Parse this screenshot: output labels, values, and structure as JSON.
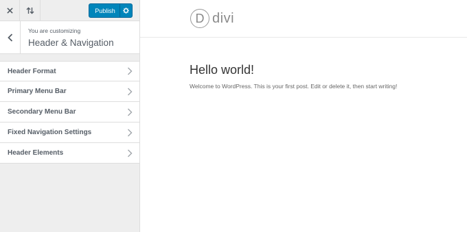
{
  "toolbar": {
    "close_icon": "close-icon",
    "preview_toggle_icon": "sort-arrows-icon",
    "publish_label": "Publish",
    "publish_settings_icon": "gear-icon",
    "accent_color": "#0085ba"
  },
  "section": {
    "subtitle": "You are customizing",
    "title": "Header & Navigation",
    "back_icon": "chevron-left-icon"
  },
  "menu": {
    "items": [
      {
        "label": "Header Format"
      },
      {
        "label": "Primary Menu Bar"
      },
      {
        "label": "Secondary Menu Bar"
      },
      {
        "label": "Fixed Navigation Settings"
      },
      {
        "label": "Header Elements"
      }
    ]
  },
  "preview": {
    "logo_letter": "D",
    "logo_text": "divi",
    "post_title": "Hello world!",
    "post_text": "Welcome to WordPress. This is your first post. Edit or delete it, then start writing!"
  }
}
